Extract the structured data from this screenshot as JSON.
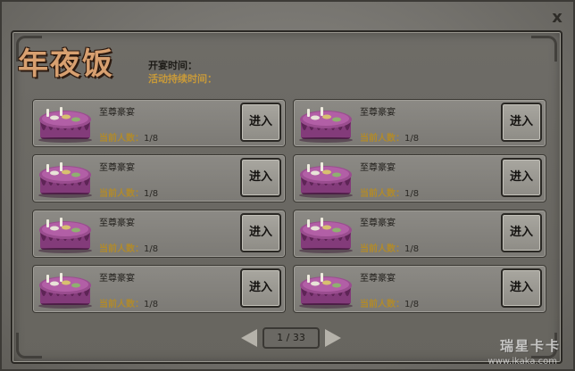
{
  "window": {
    "close_glyph": "x"
  },
  "header": {
    "title": "年夜饭",
    "open_time_label": "开宴时间：",
    "duration_label": "活动持续时间："
  },
  "rooms": [
    {
      "name": "至尊豪宴",
      "count_label": "当前人数：",
      "count": "1/8",
      "enter_label": "进入"
    },
    {
      "name": "至尊豪宴",
      "count_label": "当前人数：",
      "count": "1/8",
      "enter_label": "进入"
    },
    {
      "name": "至尊豪宴",
      "count_label": "当前人数：",
      "count": "1/8",
      "enter_label": "进入"
    },
    {
      "name": "至尊豪宴",
      "count_label": "当前人数：",
      "count": "1/8",
      "enter_label": "进入"
    },
    {
      "name": "至尊豪宴",
      "count_label": "当前人数：",
      "count": "1/8",
      "enter_label": "进入"
    },
    {
      "name": "至尊豪宴",
      "count_label": "当前人数：",
      "count": "1/8",
      "enter_label": "进入"
    },
    {
      "name": "至尊豪宴",
      "count_label": "当前人数：",
      "count": "1/8",
      "enter_label": "进入"
    },
    {
      "name": "至尊豪宴",
      "count_label": "当前人数：",
      "count": "1/8",
      "enter_label": "进入"
    }
  ],
  "pager": {
    "page_text": "1 / 33",
    "current_page": 1,
    "total_pages": 33
  },
  "watermark": {
    "brand": "瑞星卡卡",
    "url": "www.ikaka.com"
  },
  "colors": {
    "title": "#d8a070",
    "duration_label": "#c89a3a",
    "count_label": "#b08a2c",
    "table_cloth": "#8a3f80"
  }
}
